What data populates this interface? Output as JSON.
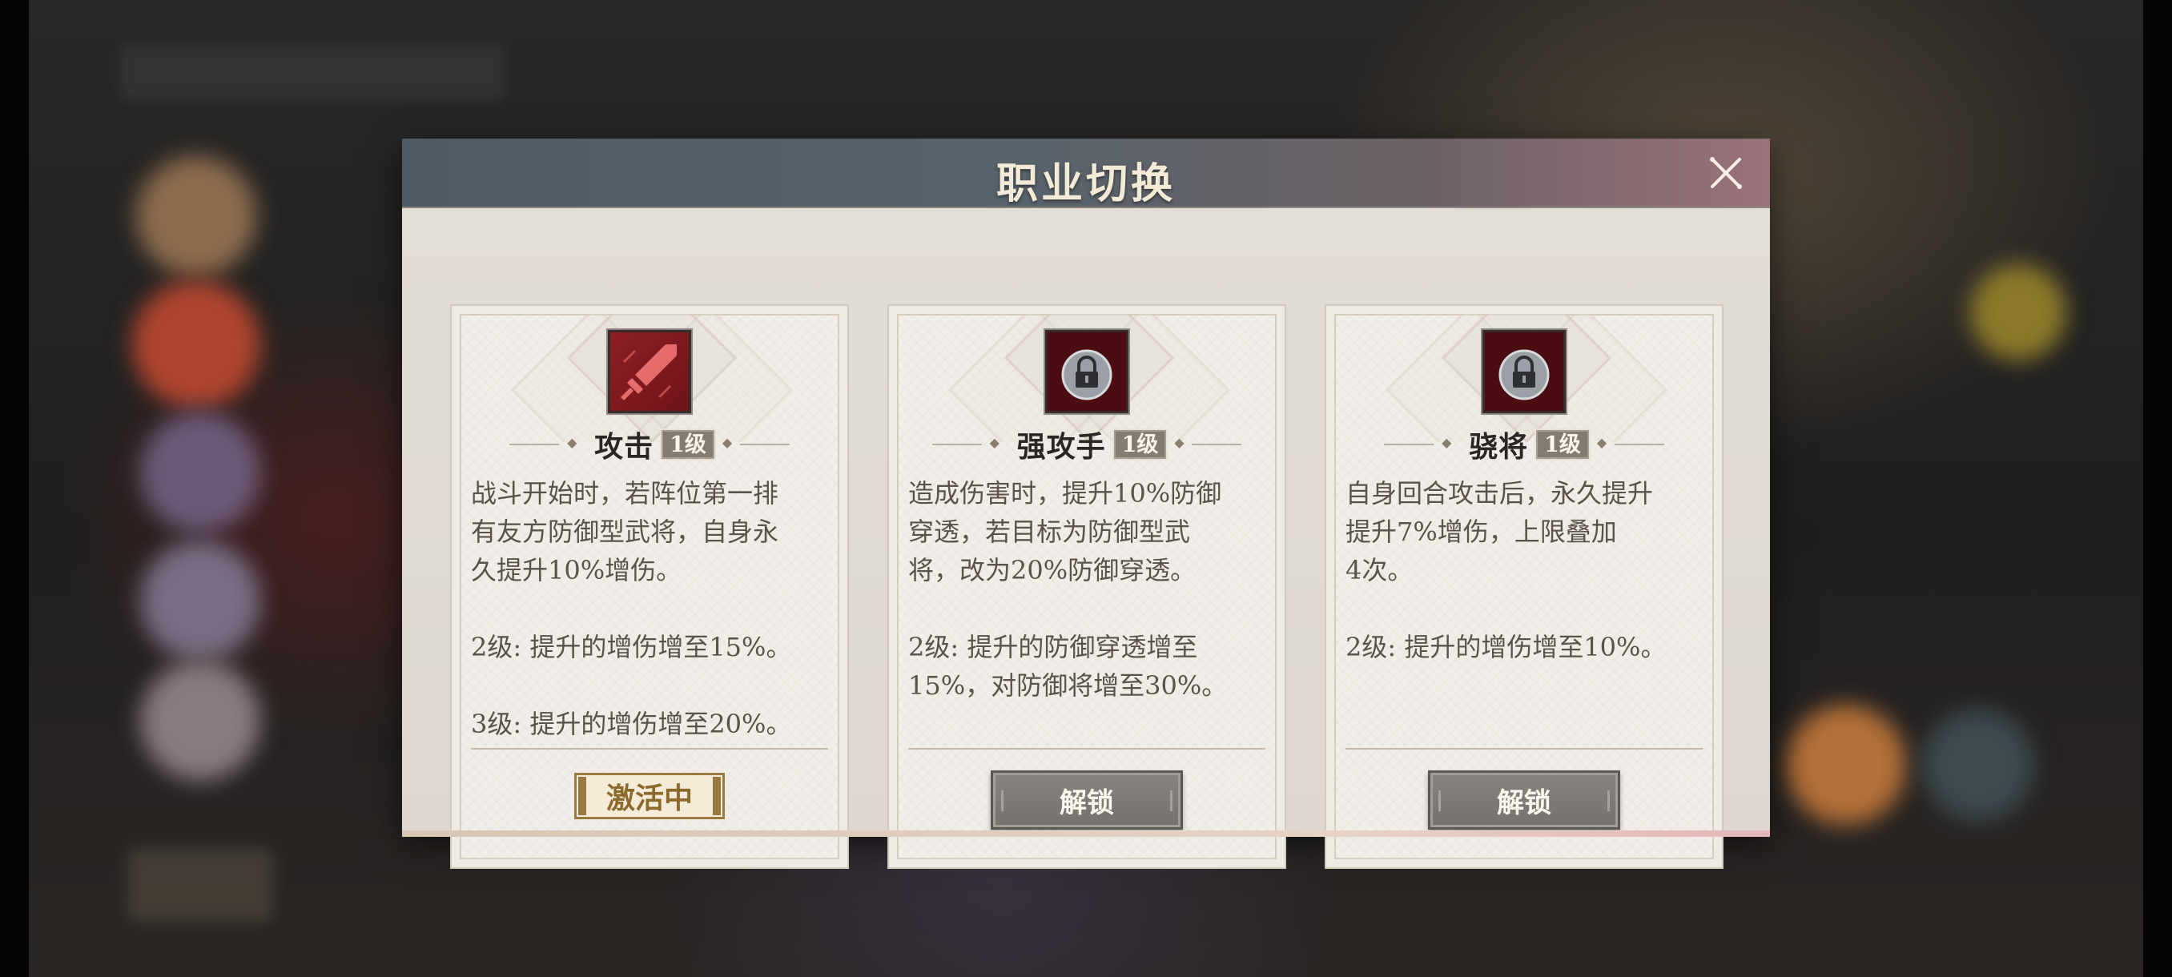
{
  "dialog": {
    "title": "职业切换"
  },
  "cards": [
    {
      "name": "攻击",
      "level": "1级",
      "icon": "sword-icon",
      "description": "战斗开始时，若阵位第一排\n有友方防御型武将，自身永\n久提升10%增伤。\n\n2级: 提升的增伤增至15%。\n\n3级: 提升的增伤增至20%。",
      "status": "激活中",
      "locked": false
    },
    {
      "name": "强攻手",
      "level": "1级",
      "icon": "lock-icon",
      "description": "造成伤害时，提升10%防御\n穿透，若目标为防御型武\n将，改为20%防御穿透。\n\n2级: 提升的防御穿透增至\n15%，对防御将增至30%。",
      "button": "解锁",
      "locked": true
    },
    {
      "name": "骁将",
      "level": "1级",
      "icon": "lock-icon",
      "description": "自身回合攻击后，永久提升\n提升7%增伤，上限叠加\n4次。\n\n2级: 提升的增伤增至10%。",
      "button": "解锁",
      "locked": true
    }
  ],
  "colors": {
    "header_start": "#4f5a64",
    "header_end": "#9a727a",
    "active_gold": "#8c6a2e",
    "icon_red": "#7a1a1f",
    "button_gray": "#7d7873"
  }
}
